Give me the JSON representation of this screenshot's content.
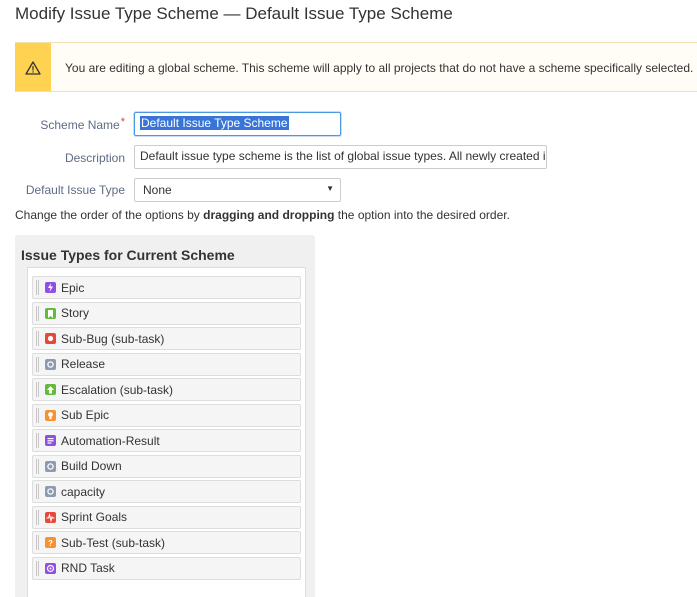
{
  "page_title": "Modify Issue Type Scheme — Default Issue Type Scheme",
  "warning": {
    "icon": "warning-icon",
    "message": "You are editing a global scheme. This scheme will apply to all projects that do not have a scheme specifically selected."
  },
  "form": {
    "scheme_name_label": "Scheme Name",
    "required_marker": "*",
    "scheme_name_value": "Default Issue Type Scheme",
    "description_label": "Description",
    "description_value": "Default issue type scheme is the list of global issue types. All newly created iss",
    "default_issue_type_label": "Default Issue Type",
    "default_issue_type_value": "None"
  },
  "hint": {
    "before": "Change the order of the options by ",
    "bold": "dragging and dropping",
    "after": " the option into the desired order."
  },
  "panel": {
    "title": "Issue Types for Current Scheme",
    "items": [
      {
        "label": "Epic",
        "icon": "epic-icon",
        "color": "#904ee2"
      },
      {
        "label": "Story",
        "icon": "story-icon",
        "color": "#63ba3c"
      },
      {
        "label": "Sub-Bug (sub-task)",
        "icon": "bug-icon",
        "color": "#e5493a"
      },
      {
        "label": "Release",
        "icon": "generic-icon",
        "color": "#8d9bb0"
      },
      {
        "label": "Escalation (sub-task)",
        "icon": "improvement-icon",
        "color": "#63ba3c"
      },
      {
        "label": "Sub Epic",
        "icon": "idea-icon",
        "color": "#f79232"
      },
      {
        "label": "Automation-Result",
        "icon": "document-icon",
        "color": "#904ee2"
      },
      {
        "label": "Build Down",
        "icon": "generic-icon",
        "color": "#8d9bb0"
      },
      {
        "label": "capacity",
        "icon": "generic-icon",
        "color": "#8d9bb0"
      },
      {
        "label": "Sprint Goals",
        "icon": "pulse-icon",
        "color": "#e5493a"
      },
      {
        "label": "Sub-Test (sub-task)",
        "icon": "question-icon",
        "color": "#f79232"
      },
      {
        "label": "RND Task",
        "icon": "target-icon",
        "color": "#904ee2"
      }
    ]
  }
}
